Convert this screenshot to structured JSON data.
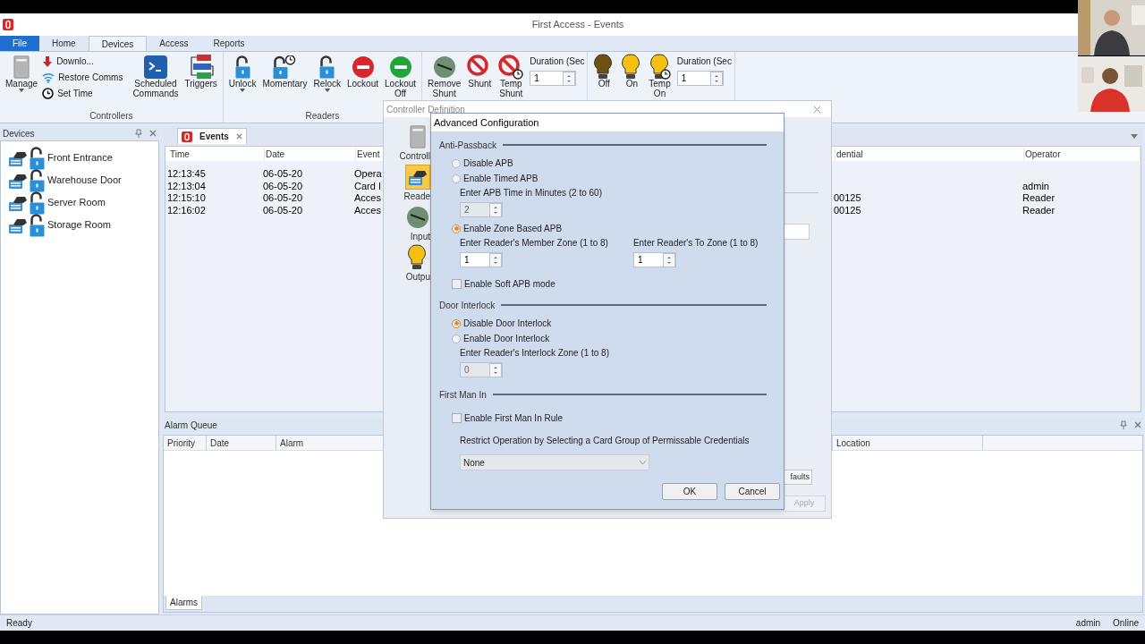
{
  "window": {
    "title": "First Access - Events"
  },
  "ribbon": {
    "tabs": [
      {
        "label": "File",
        "kind": "file",
        "selected": false
      },
      {
        "label": "Home",
        "kind": "tab",
        "selected": false
      },
      {
        "label": "Devices",
        "kind": "tab",
        "selected": true
      },
      {
        "label": "Access",
        "kind": "tab",
        "selected": false
      },
      {
        "label": "Reports",
        "kind": "tab",
        "selected": false
      }
    ],
    "groups": [
      {
        "label": "Controllers",
        "items": [
          {
            "kind": "large",
            "label": "Manage",
            "dropdown": true
          },
          {
            "kind": "stack",
            "entries": [
              "Downlo...",
              "Restore Comms",
              "Set Time"
            ]
          },
          {
            "kind": "large",
            "label": "Scheduled Commands",
            "dropdown": false
          },
          {
            "kind": "large",
            "label": "Triggers",
            "dropdown": false
          }
        ]
      },
      {
        "label": "Readers",
        "items": [
          {
            "kind": "large",
            "label": "Unlock",
            "dropdown": true
          },
          {
            "kind": "large",
            "label": "Momentary",
            "dropdown": false
          },
          {
            "kind": "large",
            "label": "Relock",
            "dropdown": true
          },
          {
            "kind": "large",
            "label": "Lockout",
            "dropdown": false
          },
          {
            "kind": "large",
            "label": "Lockout Off",
            "dropdown": false
          }
        ]
      },
      {
        "items": [
          {
            "kind": "large",
            "label": "Remove Shunt",
            "dropdown": false
          },
          {
            "kind": "large",
            "label": "Shunt",
            "dropdown": false
          },
          {
            "kind": "large",
            "label": "Temp Shunt",
            "dropdown": false
          },
          {
            "kind": "spinner",
            "label": "Duration (Sec",
            "value": "1"
          }
        ]
      },
      {
        "items": [
          {
            "kind": "large",
            "label": "Off",
            "dropdown": false
          },
          {
            "kind": "large",
            "label": "On",
            "dropdown": false
          },
          {
            "kind": "large",
            "label": "Temp On",
            "dropdown": false
          },
          {
            "kind": "spinner",
            "label": "Duration (Sec",
            "value": "1"
          }
        ]
      }
    ]
  },
  "devices": {
    "title": "Devices",
    "items": [
      "Front Entrance",
      "Warehouse Door",
      "Server Room",
      "Storage Room"
    ]
  },
  "events": {
    "tabs": [
      {
        "label": "Events",
        "selected": true
      }
    ],
    "columns": [
      "Time",
      "Date",
      "Event",
      "dential",
      "Operator"
    ],
    "rows": [
      {
        "time": "12:13:45",
        "date": "06-05-20",
        "event": "Opera"
      },
      {
        "time": "12:13:04",
        "date": "06-05-20",
        "event": "Card I",
        "operator": "admin"
      },
      {
        "time": "12:15:10",
        "date": "06-05-20",
        "event": "Acces",
        "credential": "00125",
        "operator": "Reader"
      },
      {
        "time": "12:16:02",
        "date": "06-05-20",
        "event": "Acces",
        "credential": "00125",
        "operator": "Reader"
      }
    ]
  },
  "alarm_queue": {
    "title": "Alarm Queue",
    "columns": [
      "Priority",
      "Date",
      "Alarm",
      "Location"
    ],
    "tabs": [
      {
        "label": "Alarms",
        "selected": true
      }
    ]
  },
  "status_bar": {
    "status": "Ready",
    "user": "admin",
    "connection": "Online"
  },
  "controller_dialog": {
    "title": "Controller Definition",
    "sidebar": [
      {
        "label": "Controll",
        "selected": false
      },
      {
        "label": "Reade",
        "selected": true
      },
      {
        "label": "Input",
        "selected": false
      },
      {
        "label": "Outpu",
        "selected": false
      }
    ],
    "defaults_button": "faults",
    "apply_button": {
      "label": "Apply",
      "disabled": true
    }
  },
  "advanced_dialog": {
    "title": "Advanced Configuration",
    "sections": [
      {
        "title": "Anti-Passback",
        "items": [
          {
            "kind": "radio",
            "label": "Disable APB",
            "selected": false
          },
          {
            "kind": "radio",
            "label": "Enable Timed APB",
            "selected": false
          },
          {
            "kind": "spinners",
            "fields": [
              {
                "label": "Enter APB Time in Minutes (2 to 60)",
                "value": "2",
                "disabled": true
              }
            ]
          },
          {
            "kind": "radio",
            "label": "Enable Zone Based APB",
            "selected": true
          },
          {
            "kind": "spinners",
            "fields": [
              {
                "label": "Enter Reader's Member Zone (1 to 8)",
                "value": "1",
                "disabled": false
              },
              {
                "label": "Enter Reader's To Zone (1 to 8)",
                "value": "1",
                "disabled": false
              }
            ]
          },
          {
            "kind": "checkbox",
            "label": "Enable Soft APB mode",
            "checked": false
          }
        ]
      },
      {
        "title": "Door Interlock",
        "items": [
          {
            "kind": "radio",
            "label": "Disable Door Interlock",
            "selected": true
          },
          {
            "kind": "radio",
            "label": "Enable Door Interlock",
            "selected": false
          },
          {
            "kind": "spinners",
            "fields": [
              {
                "label": "Enter Reader's Interlock Zone (1 to 8)",
                "value": "0",
                "disabled": true
              }
            ]
          }
        ]
      },
      {
        "title": "First Man In",
        "items": [
          {
            "kind": "checkbox",
            "label": "Enable First Man In Rule",
            "checked": false
          },
          {
            "kind": "note",
            "text": "Restrict Operation by Selecting a Card Group of Permissable Credentials"
          },
          {
            "kind": "dropdown",
            "value": "None",
            "disabled": true
          }
        ]
      }
    ],
    "buttons": [
      "OK",
      "Cancel"
    ]
  }
}
